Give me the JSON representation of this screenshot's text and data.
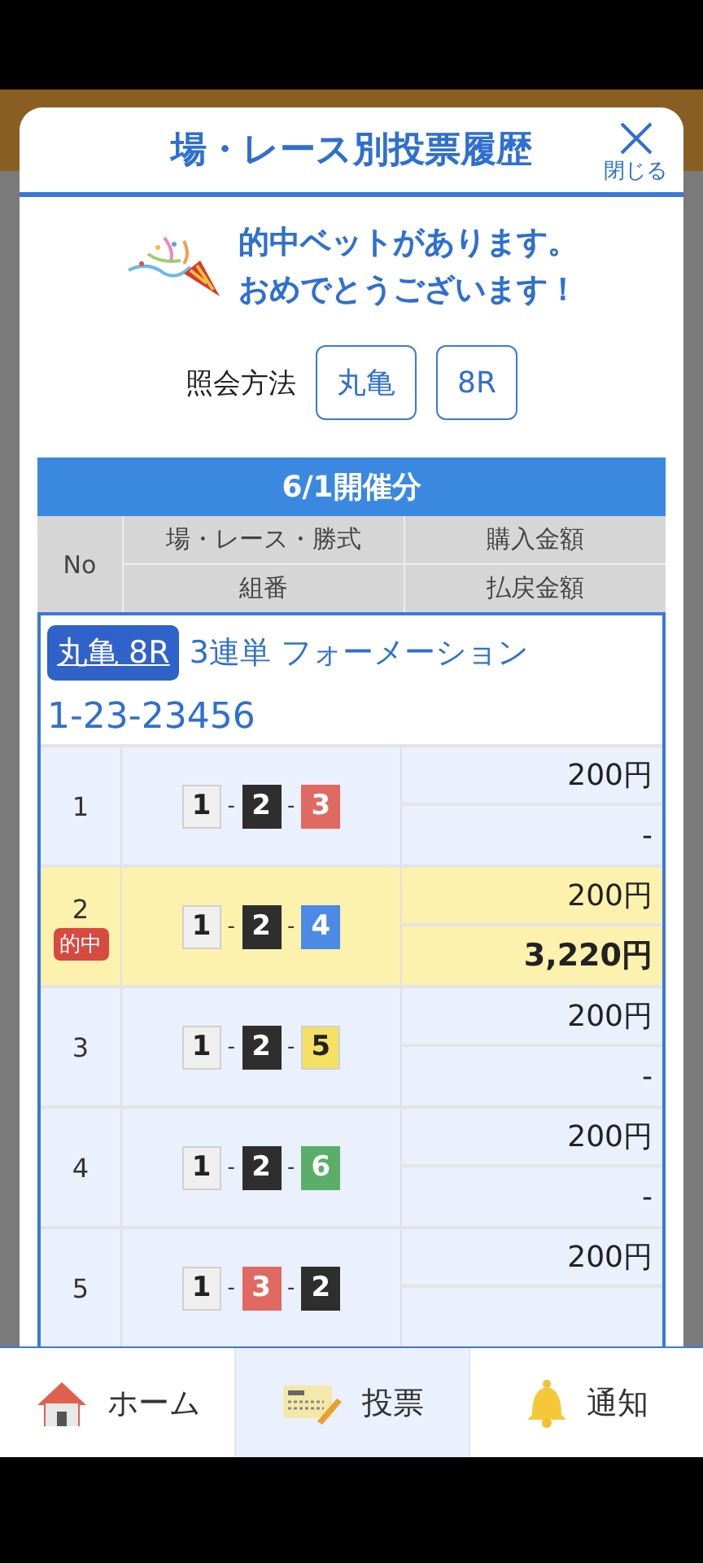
{
  "dialog": {
    "title": "場・レース別投票履歴",
    "close_label": "閉じる"
  },
  "message": [
    "的中ベットがあります。",
    "おめでとうございます！"
  ],
  "query": {
    "label": "照会方法",
    "chips": [
      "丸亀",
      "8R"
    ]
  },
  "table": {
    "date_heading": "6/1開催分",
    "hit_label": "的中",
    "combo_separator": "-",
    "columns": {
      "no": "No",
      "race": "場・レース・勝式",
      "combo": "組番",
      "amount": "購入金額",
      "payout": "払戻金額"
    },
    "groups": [
      {
        "race_link": "丸亀 8R",
        "bet_type": "3連単 フォーメーション",
        "selection": "1-23-23456",
        "rows": [
          {
            "no": "1",
            "hit": false,
            "boats": [
              {
                "number": "1",
                "color": "#efefef"
              },
              {
                "number": "2",
                "color": "#2e2e2e"
              },
              {
                "number": "3",
                "color": "#e06a62"
              }
            ],
            "amount": "200円",
            "payout": "-"
          },
          {
            "no": "2",
            "hit": true,
            "boats": [
              {
                "number": "1",
                "color": "#efefef"
              },
              {
                "number": "2",
                "color": "#2e2e2e"
              },
              {
                "number": "4",
                "color": "#4c8ae6"
              }
            ],
            "amount": "200円",
            "payout": "3,220円"
          },
          {
            "no": "3",
            "hit": false,
            "boats": [
              {
                "number": "1",
                "color": "#efefef"
              },
              {
                "number": "2",
                "color": "#2e2e2e"
              },
              {
                "number": "5",
                "color": "#f5e063"
              }
            ],
            "amount": "200円",
            "payout": "-"
          },
          {
            "no": "4",
            "hit": false,
            "boats": [
              {
                "number": "1",
                "color": "#efefef"
              },
              {
                "number": "2",
                "color": "#2e2e2e"
              },
              {
                "number": "6",
                "color": "#5aae6a"
              }
            ],
            "amount": "200円",
            "payout": "-"
          },
          {
            "no": "5",
            "hit": false,
            "boats": [
              {
                "number": "1",
                "color": "#efefef"
              },
              {
                "number": "3",
                "color": "#e06a62"
              },
              {
                "number": "2",
                "color": "#2e2e2e"
              }
            ],
            "amount": "200円"
          }
        ]
      }
    ]
  },
  "nav": [
    {
      "kind": "home",
      "label": "ホーム",
      "selected": false
    },
    {
      "kind": "ballot",
      "label": "投票",
      "selected": true
    },
    {
      "kind": "bell",
      "label": "通知",
      "selected": false
    }
  ]
}
